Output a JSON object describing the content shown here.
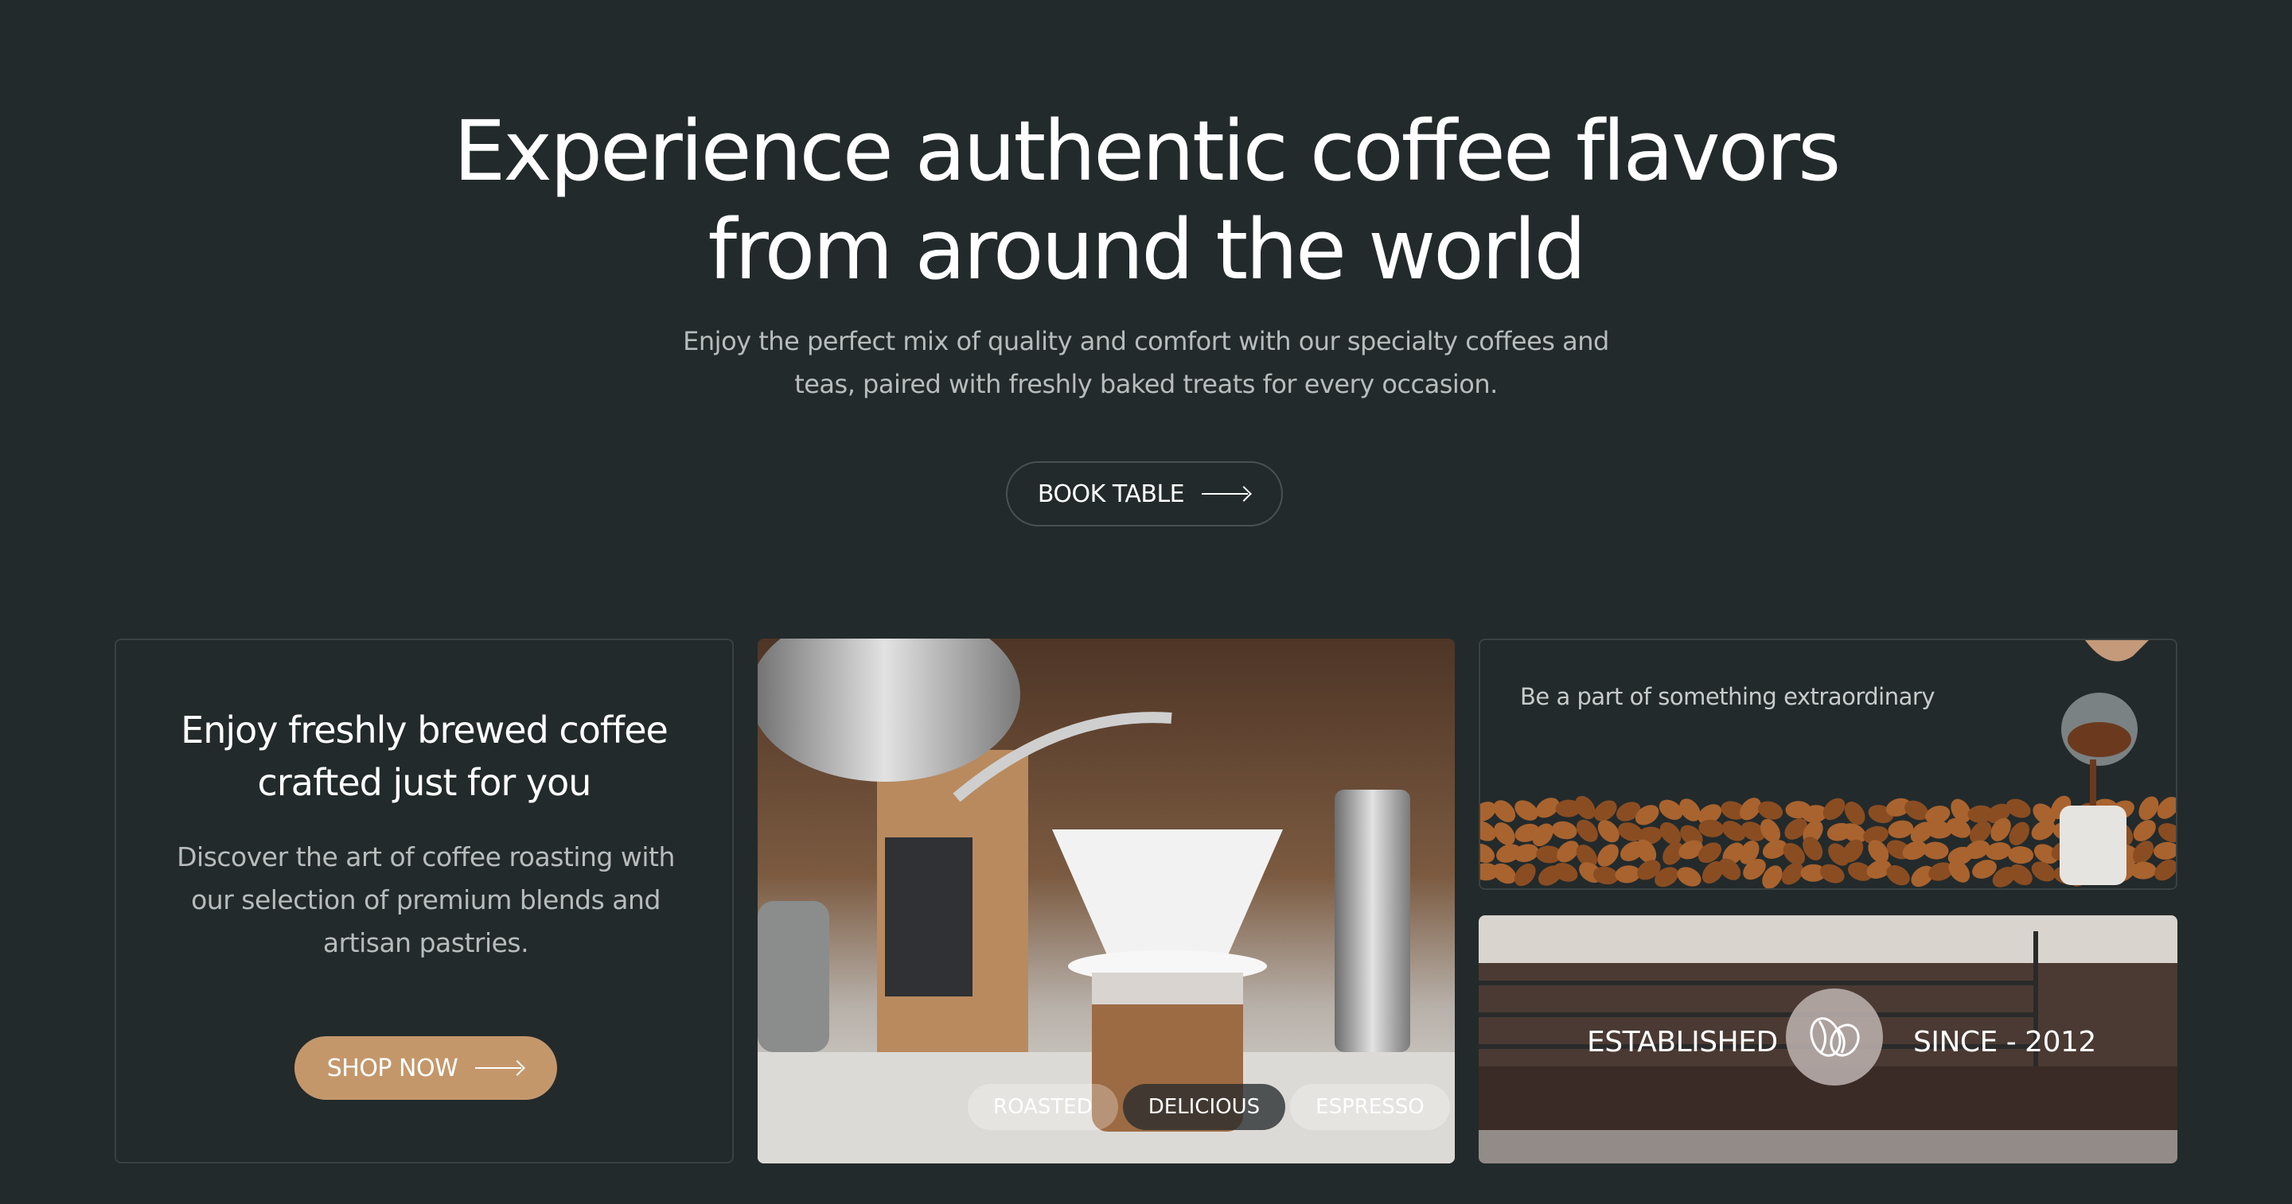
{
  "hero": {
    "title_line1": "Experience authentic coffee flavors",
    "title_line2": "from around the world",
    "subtitle_line1": "Enjoy the perfect mix of quality and comfort with our specialty coffees and",
    "subtitle_line2": "teas, paired with freshly baked treats for every occasion.",
    "book_label": "BOOK TABLE"
  },
  "feature_card": {
    "title_line1": "Enjoy freshly brewed coffee",
    "title_line2": "crafted just for you",
    "body_line1": "Discover the art of coffee roasting with",
    "body_line2": "our selection of premium blends and",
    "body_line3": "artisan pastries.",
    "shop_label": "SHOP NOW",
    "shop_color": "#c4976b"
  },
  "pour_over_card": {
    "tags": [
      "ROASTED",
      "DELICIOUS",
      "ESPRESSO"
    ],
    "active_tag": "DELICIOUS"
  },
  "community_card": {
    "text": "Be a part of something extraordinary"
  },
  "established_card": {
    "left_label": "ESTABLISHED",
    "right_label": "SINCE - 2012",
    "icon": "coffee-bean-icon"
  },
  "colors": {
    "background": "#232a2b",
    "accent": "#c4976b"
  }
}
